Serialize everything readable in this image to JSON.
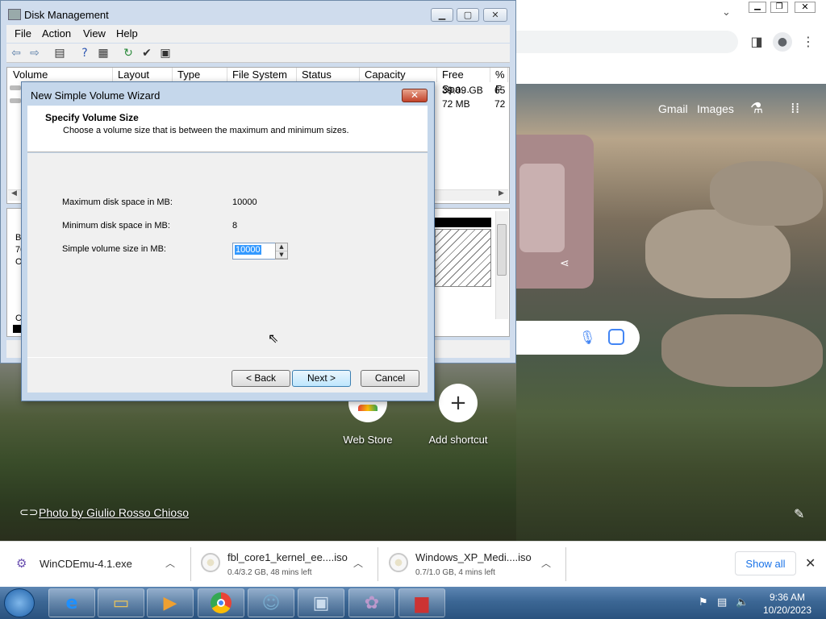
{
  "chrome": {
    "header_links": [
      "Gmail",
      "Images"
    ],
    "shortcuts": [
      {
        "label": "Web Store"
      },
      {
        "label": "Add shortcut"
      }
    ],
    "photo_credit": "Photo by Giulio Rosso Chioso"
  },
  "downloads": {
    "items": [
      {
        "name": "WinCDEmu-4.1.exe",
        "status": ""
      },
      {
        "name": "fbl_core1_kernel_ee....iso",
        "status": "0.4/3.2 GB, 48 mins left"
      },
      {
        "name": "Windows_XP_Medi....iso",
        "status": "0.7/1.0 GB, 4 mins left"
      }
    ],
    "show_all": "Show all"
  },
  "disk_management": {
    "title": "Disk Management",
    "menu": [
      "File",
      "Action",
      "View",
      "Help"
    ],
    "columns": [
      "Volume",
      "Layout",
      "Type",
      "File System",
      "Status",
      "Capacity",
      "Free Spa...",
      "% F"
    ],
    "rows": [
      {
        "free": "39.09 GB",
        "pct": "65"
      },
      {
        "free": "72 MB",
        "pct": "72"
      }
    ],
    "lower_partial": [
      "B",
      "70",
      "O",
      "C"
    ]
  },
  "wizard": {
    "title": "New Simple Volume Wizard",
    "heading": "Specify Volume Size",
    "description": "Choose a volume size that is between the maximum and minimum sizes.",
    "max_label": "Maximum disk space in MB:",
    "max_value": "10000",
    "min_label": "Minimum disk space in MB:",
    "min_value": "8",
    "size_label": "Simple volume size in MB:",
    "size_value": "10000",
    "back": "< Back",
    "next": "Next >",
    "cancel": "Cancel"
  },
  "taskbar": {
    "time": "9:36 AM",
    "date": "10/20/2023"
  }
}
